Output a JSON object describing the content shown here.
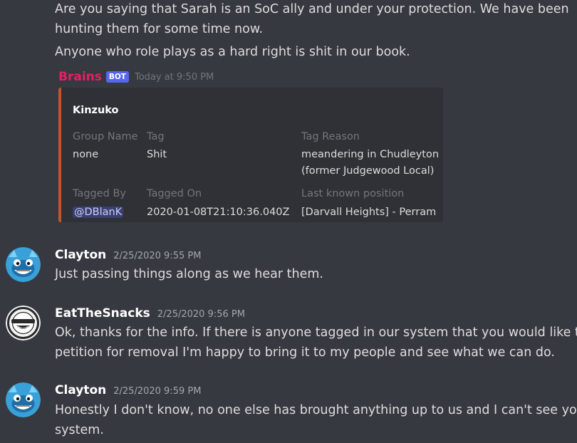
{
  "top_messages": {
    "line1": "Are you saying that Sarah is an SoC ally and under your protection.  We have been",
    "line2": "hunting them for some time now.",
    "line3": "Anyone who role plays as a hard right is shit in our book."
  },
  "bot_message": {
    "author": "Brains",
    "badge": "BOT",
    "timestamp": "Today at 9:50 PM",
    "embed": {
      "accent_color": "#c1562b",
      "title": "Kinzuko",
      "fields": {
        "group_name": {
          "name": "Group Name",
          "value": "none"
        },
        "tag": {
          "name": "Tag",
          "value": "Shit"
        },
        "tag_reason": {
          "name": "Tag Reason",
          "value_line1": "meandering in Chudleyton",
          "value_line2": "(former Judgewood Local)"
        },
        "tagged_by": {
          "name": "Tagged By",
          "value": "@DBlanK"
        },
        "tagged_on": {
          "name": "Tagged On",
          "value": "2020-01-08T21:10:36.040Z"
        },
        "last_position": {
          "name": "Last known position",
          "value": "[Darvall Heights] - Perram"
        }
      }
    }
  },
  "messages": [
    {
      "author": "Clayton",
      "timestamp": "2/25/2020 9:55 PM",
      "avatar": "blue-creature-avatar",
      "lines": [
        "Just passing things along as we hear them."
      ]
    },
    {
      "author": "EatTheSnacks",
      "timestamp": "2/25/2020 9:56 PM",
      "avatar": "laughing-man-avatar",
      "lines": [
        "Ok, thanks for the info.  If there is anyone tagged in our system that you would like to",
        "petition for removal I'm happy to bring it to my people and see what we can do."
      ]
    },
    {
      "author": "Clayton",
      "timestamp": "2/25/2020 9:59 PM",
      "avatar": "blue-creature-avatar",
      "lines": [
        "Honestly I don't know, no one else has brought anything up to us and I can't see your",
        "system."
      ]
    }
  ],
  "colors": {
    "background": "#36393f",
    "embed_background": "#2f3136",
    "bot_name": "#e91e63",
    "bot_badge": "#5865f2"
  }
}
